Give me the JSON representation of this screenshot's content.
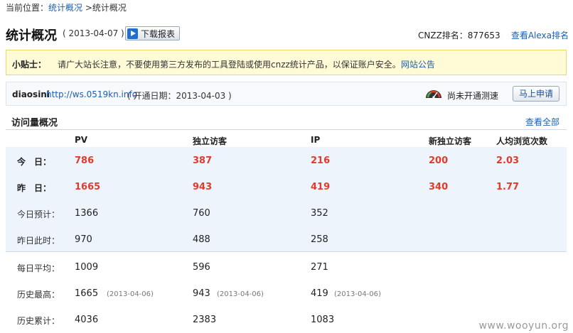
{
  "breadcrumb": {
    "prefix": "当前位置：",
    "link": "统计概况",
    "current": " >统计概况"
  },
  "header": {
    "title": "统计概况",
    "date": "( 2013-04-07 )",
    "download_label": "下载报表",
    "cnzz_rank": "CNZZ排名：877653",
    "alexa_link": "查看Alexa排名"
  },
  "tips": {
    "label": "小贴士：",
    "text": "请广大站长注意，不要使用第三方发布的工具登陆或使用cnzz统计产品，以保证账户安全。",
    "link": "网站公告"
  },
  "site": {
    "name": "diaosini",
    "url": "http://ws.0519kn.info",
    "open_date": "( 开通日期：2013-04-03 )",
    "speed_status": "尚未开通测速",
    "apply_label": "马上申请"
  },
  "section": {
    "title": "访问量概况",
    "view_all": "查看全部"
  },
  "columns": [
    "PV",
    "独立访客",
    "IP",
    "新独立访客",
    "人均浏览次数"
  ],
  "rows": [
    {
      "label": "今　日：",
      "pv": "786",
      "uv": "387",
      "ip": "216",
      "new_uv": "200",
      "avg": "2.03"
    },
    {
      "label": "昨　日：",
      "pv": "1665",
      "uv": "943",
      "ip": "419",
      "new_uv": "340",
      "avg": "1.77"
    },
    {
      "label": "今日预计：",
      "pv": "1366",
      "uv": "760",
      "ip": "352"
    },
    {
      "label": "昨日此时：",
      "pv": "970",
      "uv": "488",
      "ip": "258"
    },
    {
      "label": "每日平均：",
      "pv": "1009",
      "uv": "596",
      "ip": "271"
    },
    {
      "label": "历史最高：",
      "pv": "1665",
      "pv_date": "(2013-04-06)",
      "uv": "943",
      "uv_date": "(2013-04-06)",
      "ip": "419",
      "ip_date": "(2013-04-06)"
    },
    {
      "label": "历史累计：",
      "pv": "4036",
      "uv": "2383",
      "ip": "1083"
    }
  ],
  "watermark": "www.wooyun.org",
  "colors": {
    "accent_red": "#e03b2b",
    "link_blue": "#1a5fb4",
    "tips_bg": "#fffbd6",
    "table_bg": "#eef4fb"
  }
}
